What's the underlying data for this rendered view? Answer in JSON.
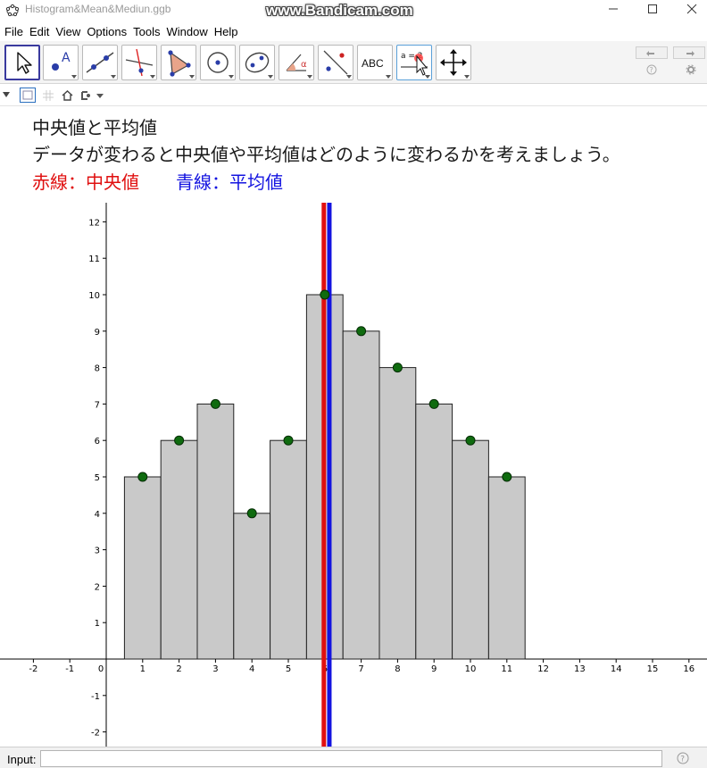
{
  "window": {
    "title": "Histogram&Mean&Mediun.ggb",
    "watermark": "www.Bandicam.com"
  },
  "menu": [
    "File",
    "Edit",
    "View",
    "Options",
    "Tools",
    "Window",
    "Help"
  ],
  "toolbar": {
    "tools": [
      {
        "name": "move-tool-icon"
      },
      {
        "name": "point-tool-icon",
        "label": "A"
      },
      {
        "name": "line-tool-icon"
      },
      {
        "name": "perpendicular-line-tool-icon"
      },
      {
        "name": "polygon-tool-icon"
      },
      {
        "name": "circle-tool-icon"
      },
      {
        "name": "ellipse-tool-icon"
      },
      {
        "name": "angle-tool-icon",
        "label": "α"
      },
      {
        "name": "reflect-tool-icon"
      },
      {
        "name": "text-tool-icon",
        "label": "ABC"
      },
      {
        "name": "slider-tool-icon",
        "label": "a = 2"
      },
      {
        "name": "move-graphics-view-icon"
      }
    ]
  },
  "text": {
    "line1": "中央値と平均値",
    "line2": "データが変わると中央値や平均値はどのように変わるかを考えましょう。",
    "median_label": "赤線：中央値",
    "mean_label": "青線：平均値"
  },
  "colors": {
    "median": "#e01010",
    "mean": "#1414e0",
    "bar_fill": "#c9c9c9",
    "point": "#0f6b0f"
  },
  "input": {
    "label": "Input:"
  },
  "chart_data": {
    "type": "bar",
    "x": [
      1,
      2,
      3,
      4,
      5,
      6,
      7,
      8,
      9,
      10,
      11
    ],
    "values": [
      5,
      6,
      7,
      4,
      6,
      10,
      9,
      8,
      7,
      6,
      5
    ],
    "bar_width": 1,
    "xlim": [
      -2.8,
      16.5
    ],
    "ylim": [
      -2.4,
      12.5
    ],
    "xticks": [
      -2,
      -1,
      0,
      1,
      2,
      3,
      4,
      5,
      6,
      7,
      8,
      9,
      10,
      11,
      12,
      13,
      14,
      15,
      16
    ],
    "yticks": [
      -2,
      -1,
      1,
      2,
      3,
      4,
      5,
      6,
      7,
      8,
      9,
      10,
      11,
      12
    ],
    "median": 6.0,
    "mean": 6.2,
    "grid": false
  }
}
